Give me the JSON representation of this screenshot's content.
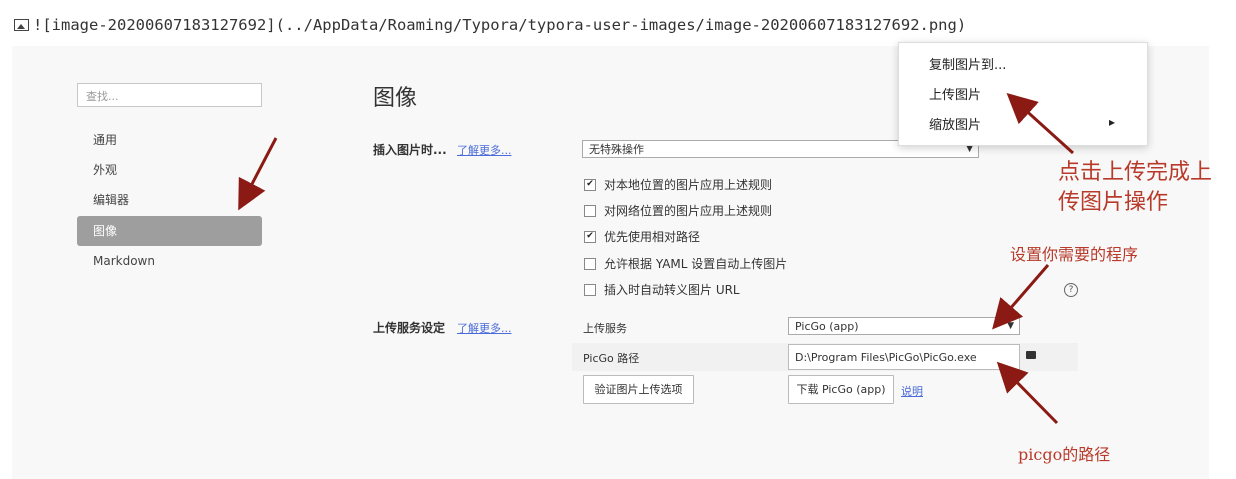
{
  "markdown_line": "![image-20200607183127692](../AppData/Roaming/Typora/typora-user-images/image-20200607183127692.png)",
  "sidebar": {
    "search_placeholder": "查找...",
    "items": [
      {
        "label": "通用"
      },
      {
        "label": "外观"
      },
      {
        "label": "编辑器"
      },
      {
        "label": "图像",
        "active": true
      },
      {
        "label": "Markdown"
      }
    ]
  },
  "main": {
    "title": "图像",
    "insert_image": {
      "label": "插入图片时...",
      "learn_more": "了解更多...",
      "select_value": "无特殊操作",
      "checkboxes": [
        {
          "label": "对本地位置的图片应用上述规则",
          "checked": true
        },
        {
          "label": "对网络位置的图片应用上述规则",
          "checked": false
        },
        {
          "label": "优先使用相对路径",
          "checked": true
        },
        {
          "label": "允许根据 YAML 设置自动上传图片",
          "checked": false
        },
        {
          "label": "插入时自动转义图片 URL",
          "checked": false
        }
      ],
      "help_icon": "?"
    },
    "upload_service": {
      "label": "上传服务设定",
      "learn_more": "了解更多...",
      "service_label": "上传服务",
      "service_value": "PicGo (app)",
      "path_label": "PicGo 路径",
      "path_value": "D:\\Program Files\\PicGo\\PicGo.exe",
      "validate_button": "验证图片上传选项",
      "download_button": "下载 PicGo (app)",
      "help_link": "说明"
    }
  },
  "context_menu": {
    "items": [
      {
        "label": "复制图片到..."
      },
      {
        "label": "上传图片"
      },
      {
        "label": "缩放图片",
        "submenu_arrow": "▸"
      }
    ]
  },
  "annotations": {
    "upload_note_line1": "点击上传完成上",
    "upload_note_line2": "传图片操作",
    "program_note": "设置你需要的程序",
    "path_note": "picgo的路径",
    "color": "#b83a2a"
  },
  "colors": {
    "panel_bg": "#f8f8f8",
    "active_nav": "#9e9e9e",
    "link": "#4a6bd8",
    "arrow": "#8b1a14"
  }
}
